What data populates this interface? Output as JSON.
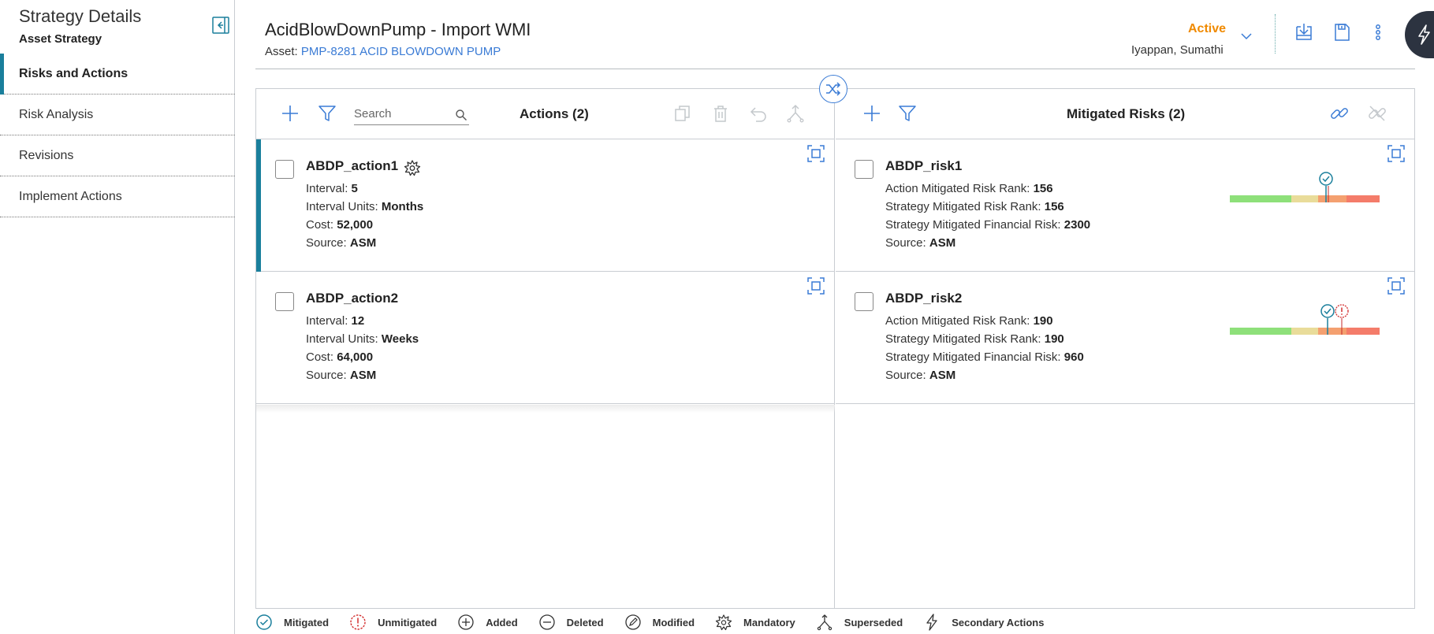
{
  "sidebar": {
    "title": "Strategy Details",
    "subtitle": "Asset Strategy",
    "items": [
      {
        "label": "Risks and Actions"
      },
      {
        "label": "Risk Analysis"
      },
      {
        "label": "Revisions"
      },
      {
        "label": "Implement Actions"
      }
    ]
  },
  "header": {
    "title": "AcidBlowDownPump - Import WMI",
    "asset_label": "Asset:",
    "asset_link": "PMP-8281 ACID BLOWDOWN PUMP",
    "state": "Active",
    "owner": "Iyappan, Sumathi",
    "colors": {
      "state": "#f08a00",
      "accent": "#1a7f9c",
      "link": "#3a7bd5"
    }
  },
  "actions_panel": {
    "title": "Actions (2)",
    "search_placeholder": "Search",
    "cards": [
      {
        "name": "ABDP_action1",
        "mandatory": true,
        "fields": [
          {
            "label": "Interval:",
            "value": "5"
          },
          {
            "label": "Interval Units:",
            "value": "Months"
          },
          {
            "label": "Cost:",
            "value": "52,000"
          },
          {
            "label": "Source:",
            "value": "ASM"
          }
        ]
      },
      {
        "name": "ABDP_action2",
        "mandatory": false,
        "fields": [
          {
            "label": "Interval:",
            "value": "12"
          },
          {
            "label": "Interval Units:",
            "value": "Weeks"
          },
          {
            "label": "Cost:",
            "value": "64,000"
          },
          {
            "label": "Source:",
            "value": "ASM"
          }
        ]
      }
    ]
  },
  "risks_panel": {
    "title": "Mitigated Risks (2)",
    "cards": [
      {
        "name": "ABDP_risk1",
        "fields": [
          {
            "label": "Action Mitigated Risk Rank:",
            "value": "156"
          },
          {
            "label": "Strategy Mitigated Risk Rank:",
            "value": "156"
          },
          {
            "label": "Strategy Mitigated Financial Risk:",
            "value": "2300"
          },
          {
            "label": "Source:",
            "value": "ASM"
          }
        ],
        "markers": [
          "mitigated"
        ]
      },
      {
        "name": "ABDP_risk2",
        "fields": [
          {
            "label": "Action Mitigated Risk Rank:",
            "value": "190"
          },
          {
            "label": "Strategy Mitigated Risk Rank:",
            "value": "190"
          },
          {
            "label": "Strategy Mitigated Financial Risk:",
            "value": "960"
          },
          {
            "label": "Source:",
            "value": "ASM"
          }
        ],
        "markers": [
          "mitigated",
          "unmitigated"
        ]
      }
    ]
  },
  "legend": [
    {
      "icon": "mitigated-icon",
      "label": "Mitigated"
    },
    {
      "icon": "unmitigated-icon",
      "label": "Unmitigated"
    },
    {
      "icon": "added-icon",
      "label": "Added"
    },
    {
      "icon": "deleted-icon",
      "label": "Deleted"
    },
    {
      "icon": "modified-icon",
      "label": "Modified"
    },
    {
      "icon": "mandatory-icon",
      "label": "Mandatory"
    },
    {
      "icon": "superseded-icon",
      "label": "Superseded"
    },
    {
      "icon": "secondary-actions-icon",
      "label": "Secondary Actions"
    }
  ]
}
